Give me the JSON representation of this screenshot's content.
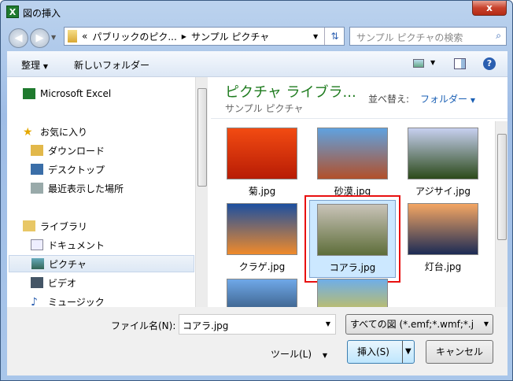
{
  "window": {
    "title": "図の挿入",
    "close": "x"
  },
  "address": {
    "overflow": "«",
    "crumbs": [
      "パブリックのピク...",
      "サンプル ピクチャ"
    ],
    "search_placeholder": "サンプル ピクチャの検索"
  },
  "toolbar": {
    "organize": "整理",
    "new_folder": "新しいフォルダー"
  },
  "sidebar": {
    "items": [
      {
        "label": "Microsoft Excel",
        "icon": "excel-icon"
      },
      {
        "label": "お気に入り",
        "icon": "star-icon"
      },
      {
        "label": "ダウンロード",
        "icon": "download-folder-icon"
      },
      {
        "label": "デスクトップ",
        "icon": "desktop-icon"
      },
      {
        "label": "最近表示した場所",
        "icon": "recent-places-icon"
      },
      {
        "label": "ライブラリ",
        "icon": "library-icon"
      },
      {
        "label": "ドキュメント",
        "icon": "documents-icon"
      },
      {
        "label": "ピクチャ",
        "icon": "pictures-icon"
      },
      {
        "label": "ビデオ",
        "icon": "videos-icon"
      },
      {
        "label": "ミュージック",
        "icon": "music-icon"
      }
    ]
  },
  "content": {
    "library_title": "ピクチャ ライブラ...",
    "subtitle": "サンプル ピクチャ",
    "sort_label": "並べ替え:",
    "sort_value": "フォルダー",
    "files": [
      {
        "name": "菊.jpg",
        "colors": [
          "#f24b12",
          "#b81c05"
        ]
      },
      {
        "name": "砂漠.jpg",
        "colors": [
          "#5fa2e0",
          "#b2502a"
        ]
      },
      {
        "name": "アジサイ.jpg",
        "colors": [
          "#c7d0f0",
          "#2c4a1a"
        ]
      },
      {
        "name": "クラゲ.jpg",
        "colors": [
          "#1c4fa0",
          "#f08a2a"
        ]
      },
      {
        "name": "コアラ.jpg",
        "colors": [
          "#c9c3b8",
          "#5e6e3a"
        ]
      },
      {
        "name": "灯台.jpg",
        "colors": [
          "#f4a663",
          "#1c2b55"
        ]
      },
      {
        "name": "",
        "colors": [
          "#6fa8e8",
          "#1d3550"
        ]
      },
      {
        "name": "",
        "colors": [
          "#6faee8",
          "#f2c714"
        ]
      }
    ],
    "selected": 4,
    "highlight": "#e81010"
  },
  "bottom": {
    "filename_label": "ファイル名(N):",
    "filename_value": "コアラ.jpg",
    "filter": "すべての図 (*.emf;*.wmf;*.j",
    "tools": "ツール(L)",
    "insert": "挿入(S)",
    "cancel": "キャンセル"
  }
}
